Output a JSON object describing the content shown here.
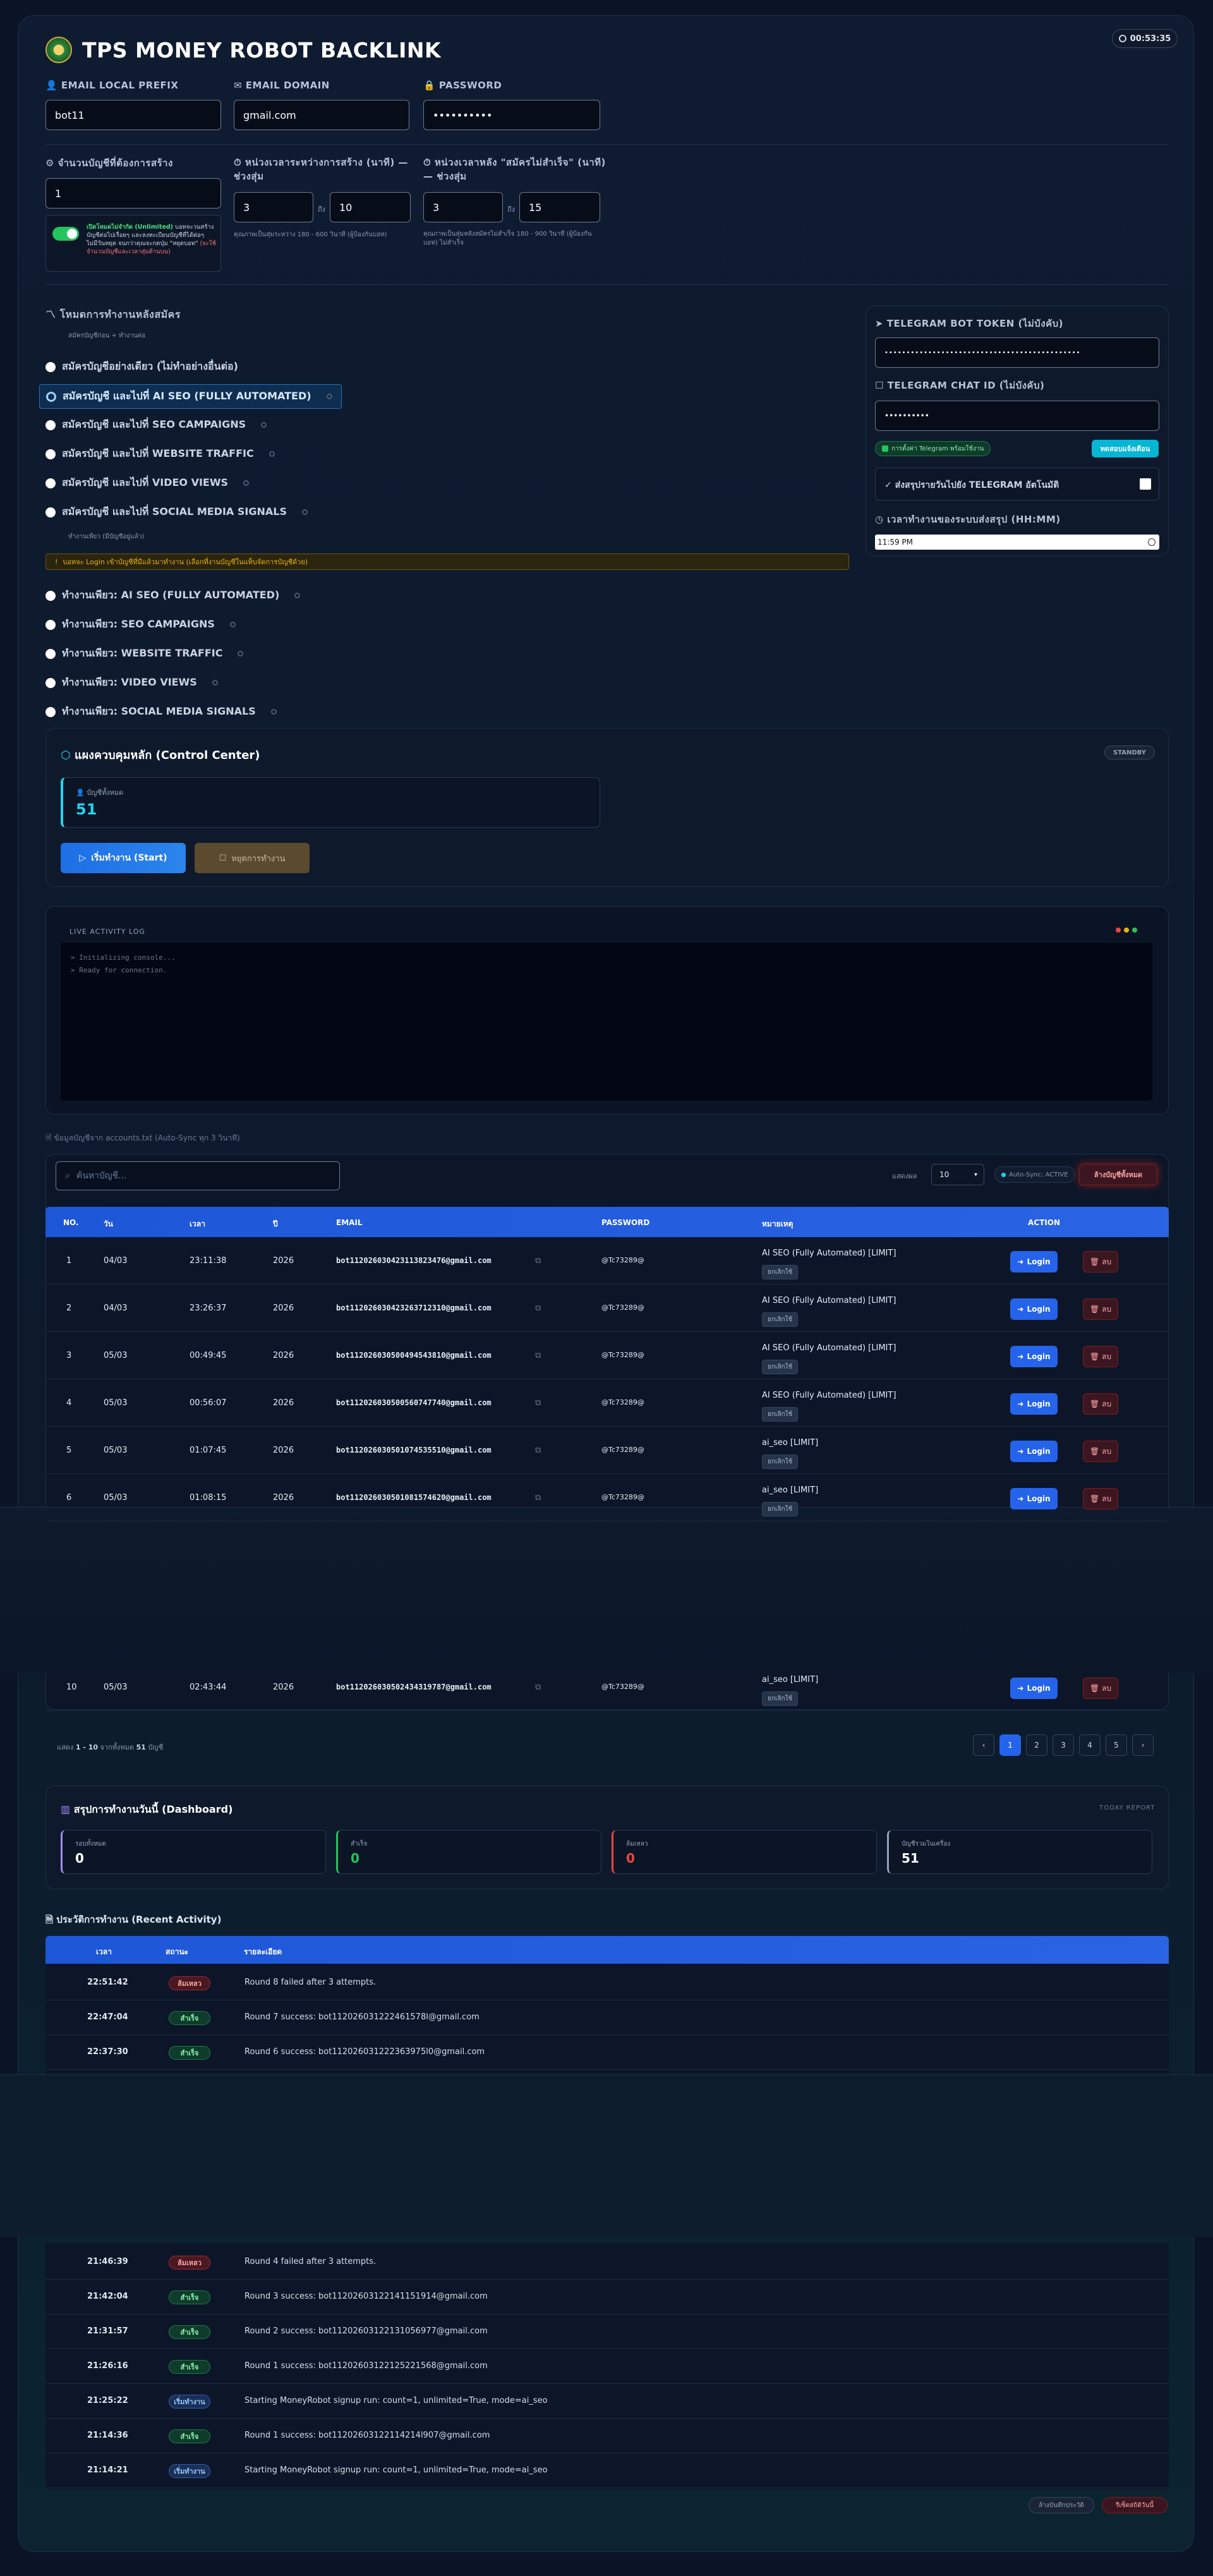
{
  "header": {
    "title": "TPS MONEY ROBOT BACKLINK",
    "timer": "00:53:35"
  },
  "form": {
    "email_prefix_label": "EMAIL LOCAL PREFIX",
    "email_prefix_value": "bot11",
    "email_domain_label": "EMAIL DOMAIN",
    "email_domain_value": "gmail.com",
    "password_label": "PASSWORD",
    "password_value": "••••••••••",
    "accounts_label": "จำนวนบัญชีที่ต้องการสร้าง",
    "accounts_value": "1",
    "delay_label": "หน่วงเวลาระหว่างการสร้าง (นาที) — ช่วงสุ่ม",
    "delay_min": "3",
    "delay_sep": "ถึง",
    "delay_max": "10",
    "delay_hint": "คุณภาพเป็นสุ่มระหว่าง 180 - 600 วินาที (ผู้ป้องกันบอท)",
    "after_label": "หน่วงเวลาหลัง \"สมัครไม่สำเร็จ\" (นาที) — ช่วงสุ่ม",
    "after_min": "3",
    "after_sep": "ถึง",
    "after_max": "15",
    "after_hint": "คุณภาพเป็นสุ่มหลังสมัครไม่สำเร็จ 180 - 900 วินาที (ผู้ป้องกันบอท) ไม่สำเร็จ",
    "toggle_text_1": "เปิดโหมดไม่จำกัด (Unlimited)",
    "toggle_text_2": " บอทจะวนสร้างบัญชีต่อไปเรื่อยๆ และลงทะเบียนบัญชีที่ได้ต่อ",
    "toggle_text_3": "ๆ ไม่มีวันหยุด จนกว่าคุณจะกดปุ่ม \"หยุดบอท\"",
    "toggle_text_4": "(จะใช้จำนวนบัญชีและเวลาสุ่มด้านบน)"
  },
  "modes": {
    "title": "โหมดการทำงานหลังสมัคร",
    "subtitle": "สมัครบัญชีก่อน + ทำงานต่อ",
    "items": [
      {
        "label": "สมัครบัญชีอย่างเดียว (ไม่ทำอย่างอื่นต่อ)"
      },
      {
        "label": "สมัครบัญชี และไปที่ AI SEO (FULLY AUTOMATED)"
      },
      {
        "label": "สมัครบัญชี และไปที่ SEO CAMPAIGNS"
      },
      {
        "label": "สมัครบัญชี และไปที่ WEBSITE TRAFFIC"
      },
      {
        "label": "สมัครบัญชี และไปที่ VIDEO VIEWS"
      },
      {
        "label": "สมัครบัญชี และไปที่ SOCIAL MEDIA SIGNALS"
      }
    ],
    "subtitle2": "ทำงานเพียว (มีบัญชีอยู่แล้ว)",
    "warning": "บอทจะ Login เข้าบัญชีที่มีแล้วมาทำงาน (เลือกที่งานบัญชีในแท็บจัดการบัญชีด้วย)",
    "items2": [
      {
        "label": "ทำงานเพียว: AI SEO (FULLY AUTOMATED)"
      },
      {
        "label": "ทำงานเพียว: SEO CAMPAIGNS"
      },
      {
        "label": "ทำงานเพียว: WEBSITE TRAFFIC"
      },
      {
        "label": "ทำงานเพียว: VIDEO VIEWS"
      },
      {
        "label": "ทำงานเพียว: SOCIAL MEDIA SIGNALS"
      }
    ]
  },
  "telegram": {
    "token_label": "TELEGRAM BOT TOKEN (ไม่บังคับ)",
    "token_value": "•••••••••••••••••••••••••••••••••••••••••••••",
    "chat_label": "TELEGRAM CHAT ID (ไม่บังคับ)",
    "chat_value": "••••••••••",
    "status": "การตั้งค่า Telegram พร้อมใช้งาน",
    "test_button": "ทดสอบแจ้งเตือน",
    "daily_label": "ส่งสรุปรายวันไปยัง TELEGRAM อัตโนมัติ",
    "time_label": "เวลาทำงานของระบบส่งสรุป (HH:MM)",
    "time_value": "11:59 PM"
  },
  "control": {
    "title": "แผงควบคุมหลัก (Control Center)",
    "state": "STANDBY",
    "stat_label": "บัญชีทั้งหมด",
    "stat_value": "51",
    "start": "เริ่มทำงาน (Start)",
    "stop": "หยุดการทำงาน"
  },
  "log": {
    "title": "LIVE ACTIVITY LOG",
    "lines": [
      "> Initializing console...",
      "> Ready for connection."
    ]
  },
  "accounts": {
    "file_label": "ข้อมูลบัญชีจาก accounts.txt (Auto-Sync ทุก 3 วินาที)",
    "search_placeholder": "ค้นหาบัญชี...",
    "show_label": "แสดงผล",
    "show_value": "10",
    "sync": "Auto-Sync: ACTIVE",
    "delete_all": "ล้างบัญชีทั้งหมด",
    "columns": [
      "NO.",
      "วัน",
      "เวลา",
      "ปี",
      "EMAIL",
      "PASSWORD",
      "หมายเหตุ",
      "ACTION"
    ],
    "rows": [
      {
        "no": "1",
        "day": "04/03",
        "time": "23:11:38",
        "year": "2026",
        "email": "bot112026030423113823476@gmail.com",
        "pass": "@Tc73289@",
        "note": "AI SEO (Fully Automated) [LIMIT]",
        "tag": "ยกเลิกใช้"
      },
      {
        "no": "2",
        "day": "04/03",
        "time": "23:26:37",
        "year": "2026",
        "email": "bot112026030423263712310@gmail.com",
        "pass": "@Tc73289@",
        "note": "AI SEO (Fully Automated) [LIMIT]",
        "tag": "ยกเลิกใช้"
      },
      {
        "no": "3",
        "day": "05/03",
        "time": "00:49:45",
        "year": "2026",
        "email": "bot112026030500494543810@gmail.com",
        "pass": "@Tc73289@",
        "note": "AI SEO (Fully Automated) [LIMIT]",
        "tag": "ยกเลิกใช้"
      },
      {
        "no": "4",
        "day": "05/03",
        "time": "00:56:07",
        "year": "2026",
        "email": "bot112026030500560747740@gmail.com",
        "pass": "@Tc73289@",
        "note": "AI SEO (Fully Automated) [LIMIT]",
        "tag": "ยกเลิกใช้"
      },
      {
        "no": "5",
        "day": "05/03",
        "time": "01:07:45",
        "year": "2026",
        "email": "bot112026030501074535510@gmail.com",
        "pass": "@Tc73289@",
        "note": "ai_seo [LIMIT]",
        "tag": "ยกเลิกใช้"
      },
      {
        "no": "6",
        "day": "05/03",
        "time": "01:08:15",
        "year": "2026",
        "email": "bot112026030501081574620@gmail.com",
        "pass": "@Tc73289@",
        "note": "ai_seo [LIMIT]",
        "tag": "ยกเลิกใช้"
      },
      {
        "no": "10",
        "day": "05/03",
        "time": "02:43:44",
        "year": "2026",
        "email": "bot112026030502434319787@gmail.com",
        "pass": "@Tc73289@",
        "note": "ai_seo [LIMIT]",
        "tag": "ยกเลิกใช้"
      }
    ],
    "login": "Login",
    "del": "ลบ",
    "summary_prefix": "แสดง ",
    "summary_range": "1 - 10",
    "summary_mid": " จากทั้งหมด ",
    "summary_total": "51",
    "summary_suffix": " บัญชี",
    "pages": [
      "‹",
      "1",
      "2",
      "3",
      "4",
      "5",
      "›"
    ]
  },
  "dashboard": {
    "title": "สรุปการทำงานวันนี้ (Dashboard)",
    "tag": "TODAY REPORT",
    "stats": [
      {
        "label": "รอบทั้งหมด",
        "value": "0"
      },
      {
        "label": "สำเร็จ",
        "value": "0"
      },
      {
        "label": "ล้มเหลว",
        "value": "0"
      },
      {
        "label": "บัญชีรวมในเครื่อง",
        "value": "51"
      }
    ]
  },
  "activity": {
    "title": "ประวัติการทำงาน (Recent Activity)",
    "columns": [
      "เวลา",
      "สถานะ",
      "รายละเอียด"
    ],
    "rows_top": [
      {
        "time": "22:51:42",
        "status": "ล้มเหลว",
        "kind": "fail",
        "detail": "Round 8 failed after 3 attempts."
      },
      {
        "time": "22:47:04",
        "status": "สำเร็จ",
        "kind": "ok",
        "detail": "Round 7 success: bot112026031222461578l@gmail.com"
      },
      {
        "time": "22:37:30",
        "status": "สำเร็จ",
        "kind": "ok",
        "detail": "Round 6 success: bot112026031222363975l0@gmail.com"
      }
    ],
    "rows_bottom": [
      {
        "time": "21:46:39",
        "status": "ล้มเหลว",
        "kind": "fail",
        "detail": "Round 4 failed after 3 attempts."
      },
      {
        "time": "21:42:04",
        "status": "สำเร็จ",
        "kind": "ok",
        "detail": "Round 3 success: bot11202603122141151914@gmail.com"
      },
      {
        "time": "21:31:57",
        "status": "สำเร็จ",
        "kind": "ok",
        "detail": "Round 2 success: bot11202603122131056977@gmail.com"
      },
      {
        "time": "21:26:16",
        "status": "สำเร็จ",
        "kind": "ok",
        "detail": "Round 1 success: bot11202603122125221568@gmail.com"
      },
      {
        "time": "21:25:22",
        "status": "เริ่มทำงาน",
        "kind": "start",
        "detail": "Starting MoneyRobot signup run: count=1, unlimited=True, mode=ai_seo"
      },
      {
        "time": "21:14:36",
        "status": "สำเร็จ",
        "kind": "ok",
        "detail": "Round 1 success: bot11202603122114214l907@gmail.com"
      },
      {
        "time": "21:14:21",
        "status": "เริ่มทำงาน",
        "kind": "start",
        "detail": "Starting MoneyRobot signup run: count=1, unlimited=True, mode=ai_seo"
      }
    ],
    "clear_button": "ล้างบันทึกประวัติ",
    "reset_button": "รีเซ็ตสถิติวันนี้"
  }
}
